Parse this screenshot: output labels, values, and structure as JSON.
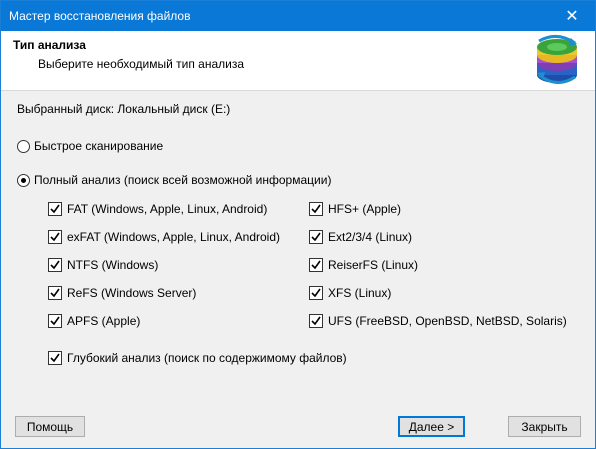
{
  "window": {
    "title": "Мастер восстановления файлов",
    "close_glyph": "✕"
  },
  "header": {
    "title": "Тип анализа",
    "subtitle": "Выберите необходимый тип анализа",
    "logo_icon": "recovery-disk-logo-icon"
  },
  "drive": {
    "label": "Выбранный диск: Локальный диск (E:)"
  },
  "scan_options": {
    "quick": {
      "label": "Быстрое сканирование",
      "selected": false
    },
    "full": {
      "label": "Полный анализ (поиск всей возможной информации)",
      "selected": true
    }
  },
  "filesystems_left": [
    {
      "label": "FAT (Windows, Apple, Linux, Android)",
      "checked": true
    },
    {
      "label": "exFAT (Windows, Apple, Linux, Android)",
      "checked": true
    },
    {
      "label": "NTFS (Windows)",
      "checked": true
    },
    {
      "label": "ReFS (Windows Server)",
      "checked": true
    },
    {
      "label": "APFS (Apple)",
      "checked": true
    }
  ],
  "filesystems_right": [
    {
      "label": "HFS+ (Apple)",
      "checked": true
    },
    {
      "label": "Ext2/3/4 (Linux)",
      "checked": true
    },
    {
      "label": "ReiserFS (Linux)",
      "checked": true
    },
    {
      "label": "XFS (Linux)",
      "checked": true
    },
    {
      "label": "UFS (FreeBSD, OpenBSD, NetBSD, Solaris)",
      "checked": true
    }
  ],
  "deep": {
    "label": "Глубокий анализ (поиск по содержимому файлов)",
    "checked": true
  },
  "buttons": {
    "help": "Помощь",
    "next": "Далее >",
    "close": "Закрыть"
  }
}
